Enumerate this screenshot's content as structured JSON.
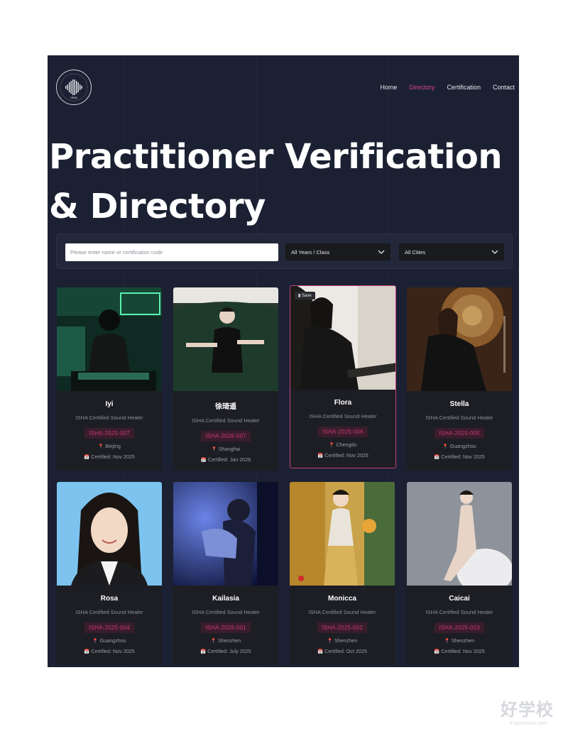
{
  "brand": {
    "logo_text": "ISHA"
  },
  "nav": {
    "items": [
      {
        "label": "Home",
        "active": false
      },
      {
        "label": "Directory",
        "active": true
      },
      {
        "label": "Certification",
        "active": false
      },
      {
        "label": "Contact",
        "active": false
      }
    ]
  },
  "hero": {
    "line1": "Practitioner Verification",
    "line2": "& Directory"
  },
  "filters": {
    "search_placeholder": "Please enter name or certification code",
    "year_select": "All Years / Class",
    "city_select": "All Cities"
  },
  "save_label": "Save",
  "cards": [
    {
      "name": "Iyi",
      "title": "ISHA Certified Sound Healer",
      "code": "ISHA-2025-007",
      "city": "Beijing",
      "certified": "Certified: Nov 2025"
    },
    {
      "name": "徐琦遥",
      "title": "ISHA Certified Sound Healer",
      "code": "ISHA-2026-007",
      "city": "Shanghai",
      "certified": "Certified: Jan 2026"
    },
    {
      "name": "Flora",
      "title": "ISHA Certified Sound Healer",
      "code": "ISHA-2025-006",
      "city": "Chengdu",
      "certified": "Certified: Nov 2025"
    },
    {
      "name": "Stella",
      "title": "ISHA Certified Sound Healer",
      "code": "ISHA-2025-005",
      "city": "Guangzhou",
      "certified": "Certified: Nov 2025"
    },
    {
      "name": "Rosa",
      "title": "ISHA Certified Sound Healer",
      "code": "ISHA-2025-004",
      "city": "Guangzhou",
      "certified": "Certified: Nov 2025"
    },
    {
      "name": "Kailasia",
      "title": "ISHA Certified Sound Healer",
      "code": "ISHA-2025-001",
      "city": "Shenzhen",
      "certified": "Certified: July 2025"
    },
    {
      "name": "Monicca",
      "title": "ISHA Certified Sound Healer",
      "code": "ISHA-2025-002",
      "city": "Shenzhen",
      "certified": "Certified: Oct 2025"
    },
    {
      "name": "Caicai",
      "title": "ISHA Certified Sound Healer",
      "code": "ISHA-2025-003",
      "city": "Shenzhen",
      "certified": "Certified: Nov 2025"
    }
  ],
  "watermark": {
    "text": "好学校",
    "sub": "51qixuexiao.com"
  },
  "colors": {
    "accent": "#d6438f",
    "page_bg": "#1b2132",
    "card_bg": "#1d1e24",
    "code_bg": "#3a1d2a"
  }
}
